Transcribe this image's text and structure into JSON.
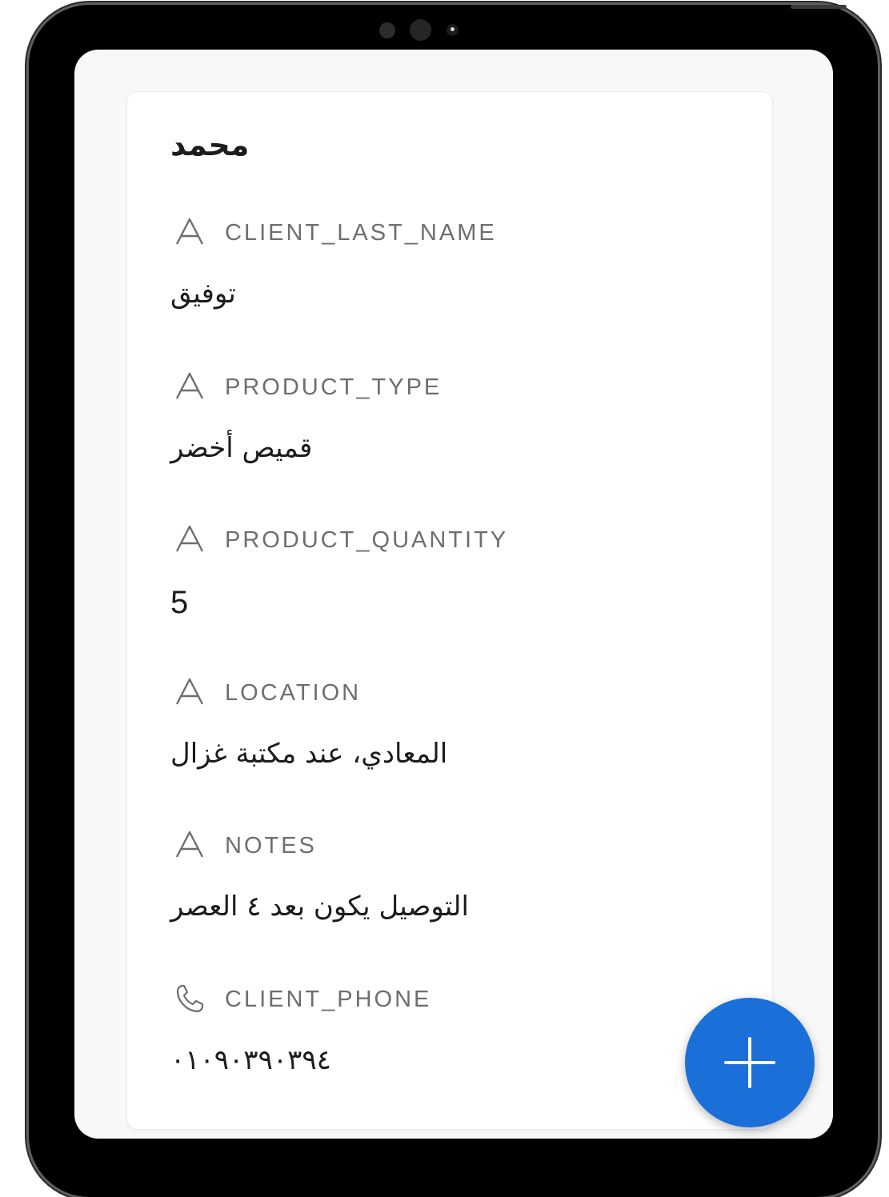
{
  "record": {
    "title": "محمد",
    "fields": [
      {
        "label": "CLIENT_LAST_NAME",
        "value": "توفيق",
        "icon": "text-type-icon"
      },
      {
        "label": "PRODUCT_TYPE",
        "value": "قميص أخضر",
        "icon": "text-type-icon"
      },
      {
        "label": "PRODUCT_QUANTITY",
        "value": "5",
        "icon": "text-type-icon"
      },
      {
        "label": "LOCATION",
        "value": "المعادي، عند مكتبة غزال",
        "icon": "text-type-icon"
      },
      {
        "label": "NOTES",
        "value": "التوصيل يكون بعد ٤ العصر",
        "icon": "text-type-icon"
      },
      {
        "label": "CLIENT_PHONE",
        "value": "٠١٠٩٠٣٩٠٣٩٤",
        "icon": "phone-icon"
      }
    ]
  },
  "fab": {
    "icon": "plus-icon",
    "color": "#1b6fd9"
  }
}
